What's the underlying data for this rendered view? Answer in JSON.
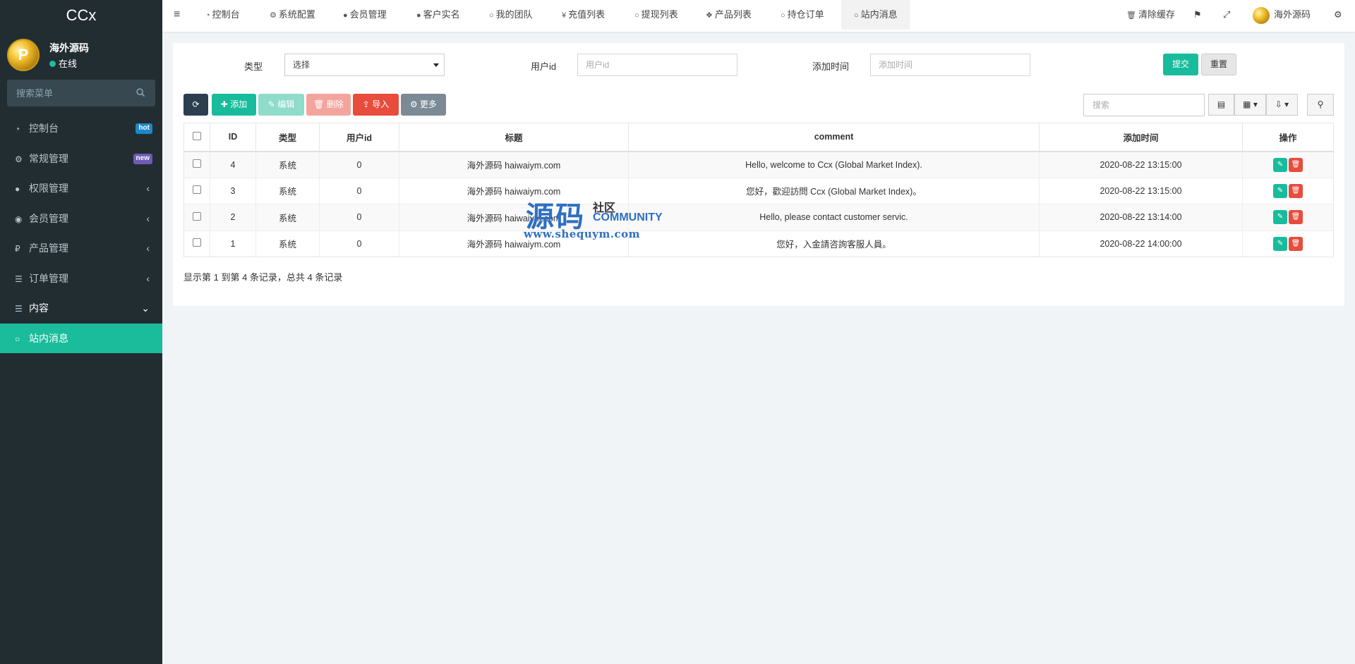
{
  "sidebar": {
    "brand": "CCx",
    "user": {
      "name": "海外源码",
      "status": "在线",
      "avatar_letter": "P"
    },
    "search_placeholder": "搜索菜单",
    "items": [
      {
        "label": "控制台",
        "icon": "dashboard-icon",
        "badge": "hot"
      },
      {
        "label": "常规管理",
        "icon": "cogs-icon",
        "badge": "new"
      },
      {
        "label": "权限管理",
        "icon": "users-icon",
        "arrow": "‹"
      },
      {
        "label": "会员管理",
        "icon": "user-circle-icon",
        "arrow": "‹"
      },
      {
        "label": "产品管理",
        "icon": "rouble-icon",
        "arrow": "‹"
      },
      {
        "label": "订单管理",
        "icon": "list-icon",
        "arrow": "‹"
      },
      {
        "label": "内容",
        "icon": "list-icon",
        "arrow": "⌄"
      },
      {
        "label": "站内消息",
        "icon": "circle-icon"
      }
    ]
  },
  "topbar": {
    "tabs": [
      {
        "label": "控制台",
        "icon": "dashboard-icon"
      },
      {
        "label": "系统配置",
        "icon": "gear-icon"
      },
      {
        "label": "会员管理",
        "icon": "user-icon"
      },
      {
        "label": "客户实名",
        "icon": "user-icon"
      },
      {
        "label": "我的团队",
        "icon": "circle-icon"
      },
      {
        "label": "充值列表",
        "icon": "yen-icon"
      },
      {
        "label": "提现列表",
        "icon": "circle-icon"
      },
      {
        "label": "产品列表",
        "icon": "cubes-icon"
      },
      {
        "label": "持仓订单",
        "icon": "circle-icon"
      },
      {
        "label": "站内消息",
        "icon": "circle-icon"
      }
    ],
    "clear_cache": "清除缓存",
    "username": "海外源码"
  },
  "filter": {
    "type_label": "类型",
    "type_value": "选择",
    "userid_label": "用户id",
    "userid_placeholder": "用户id",
    "time_label": "添加时间",
    "time_placeholder": "添加时间",
    "submit": "提交",
    "reset": "重置"
  },
  "toolbar": {
    "add": "添加",
    "edit": "编辑",
    "delete": "删除",
    "import": "导入",
    "more": "更多",
    "search_placeholder": "搜索"
  },
  "table": {
    "headers": [
      "ID",
      "类型",
      "用户id",
      "标题",
      "comment",
      "添加时间",
      "操作"
    ],
    "rows": [
      {
        "id": "4",
        "type": "系统",
        "userid": "0",
        "title": "海外源码 haiwaiym.com",
        "comment": "Hello, welcome to Ccx (Global Market Index).",
        "time": "2020-08-22 13:15:00"
      },
      {
        "id": "3",
        "type": "系统",
        "userid": "0",
        "title": "海外源码 haiwaiym.com",
        "comment": "您好，歡迎訪問 Ccx (Global Market Index)。",
        "time": "2020-08-22 13:15:00"
      },
      {
        "id": "2",
        "type": "系统",
        "userid": "0",
        "title": "海外源码 haiwaiym.com",
        "comment": "Hello, please contact customer servic.",
        "time": "2020-08-22 13:14:00"
      },
      {
        "id": "1",
        "type": "系统",
        "userid": "0",
        "title": "海外源码 haiwaiym.com",
        "comment": "您好，入金請咨詢客服人員。",
        "time": "2020-08-22 14:00:00"
      }
    ],
    "summary": "显示第 1 到第 4 条记录，总共 4 条记录"
  },
  "watermark": {
    "cn": "源码",
    "sub": "社区",
    "community": "COMMUNITY",
    "url": "www.shequym.com"
  },
  "colors": {
    "sidebar": "#222d32",
    "accent": "#18bc9c",
    "danger": "#e74c3c"
  }
}
